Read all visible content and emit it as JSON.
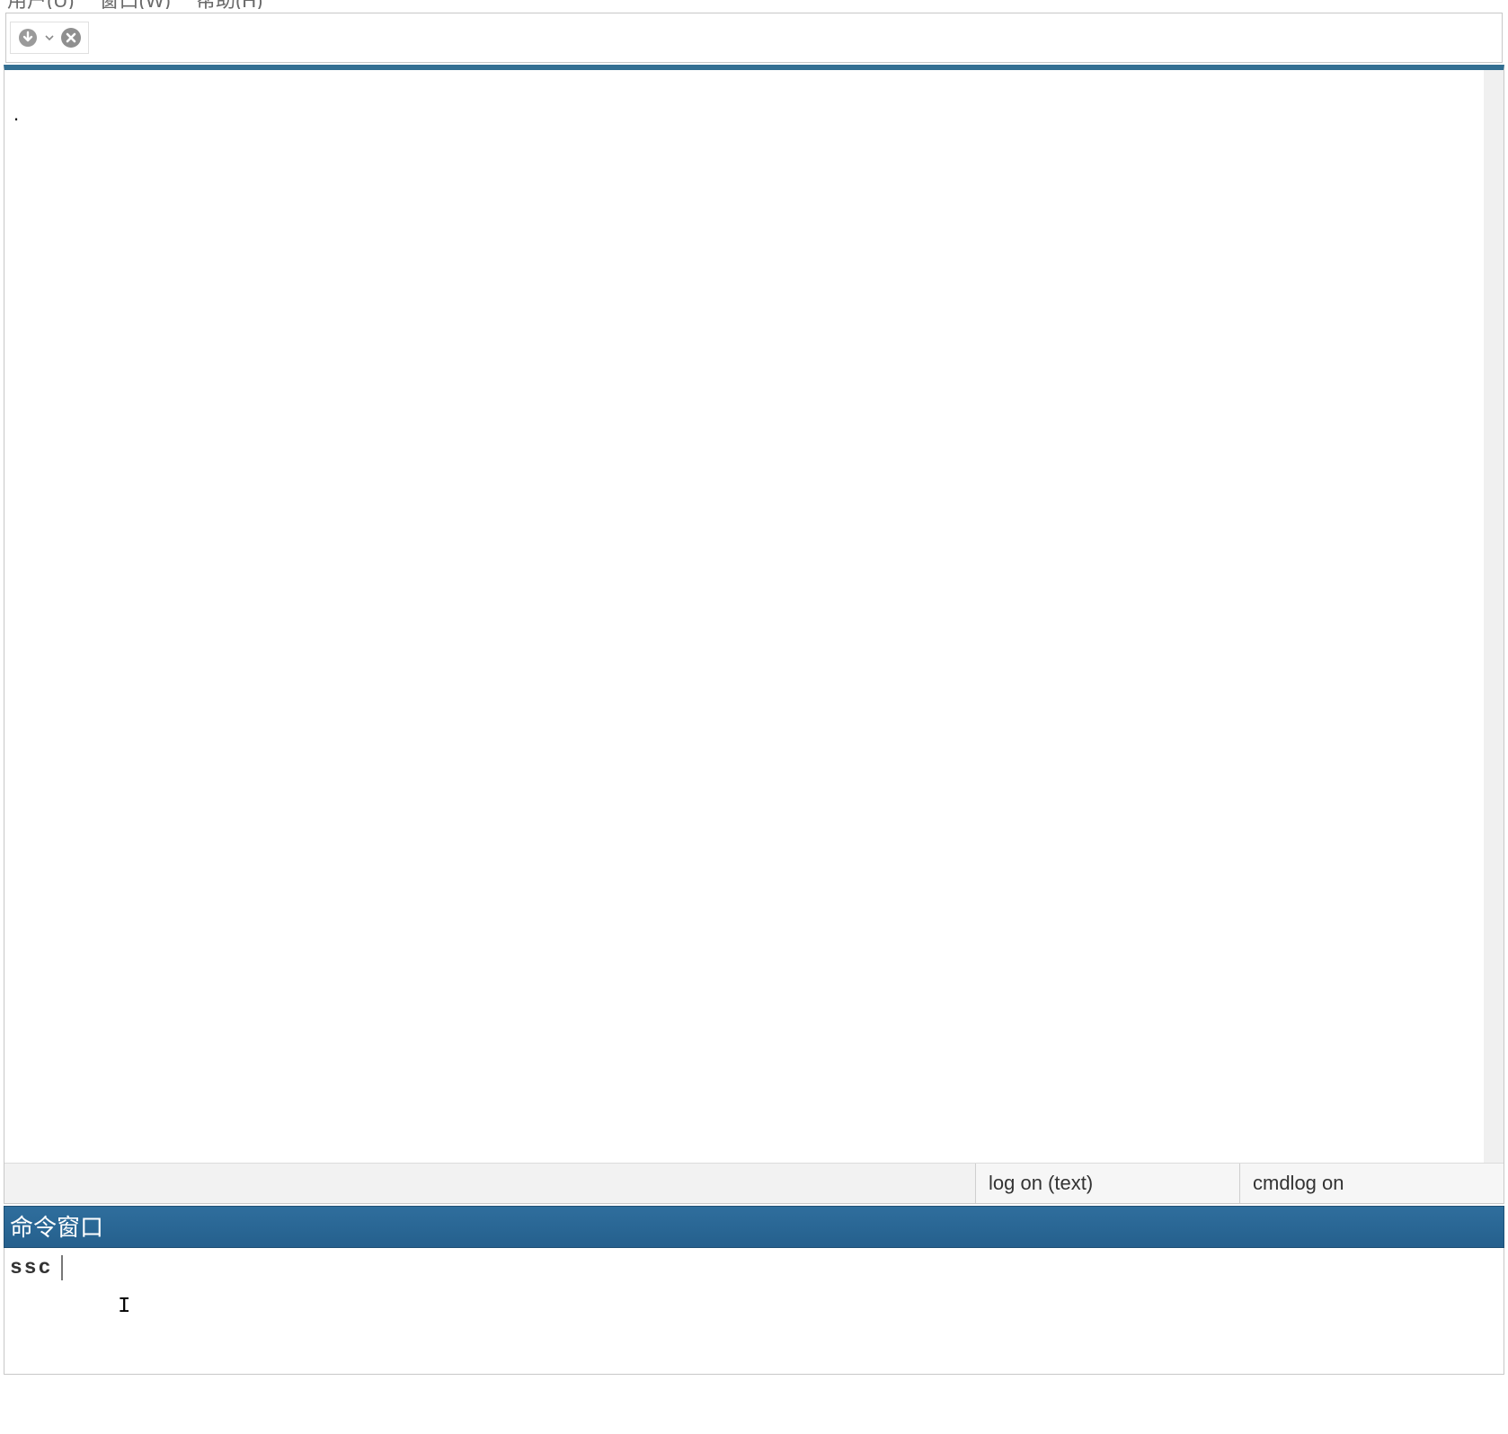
{
  "menubar": {
    "user": "用户(U)",
    "window": "窗口(W)",
    "help": "帮助(H)"
  },
  "toolbar": {
    "log_icon": "log-arrow",
    "stop_icon": "stop-x"
  },
  "results": {
    "content_dot": "."
  },
  "statusbar": {
    "log_text": "log on (text)",
    "cmdlog": "cmdlog on"
  },
  "command_window": {
    "title": "命令窗口",
    "input_value": "ssc",
    "cursor_glyph": "I"
  }
}
